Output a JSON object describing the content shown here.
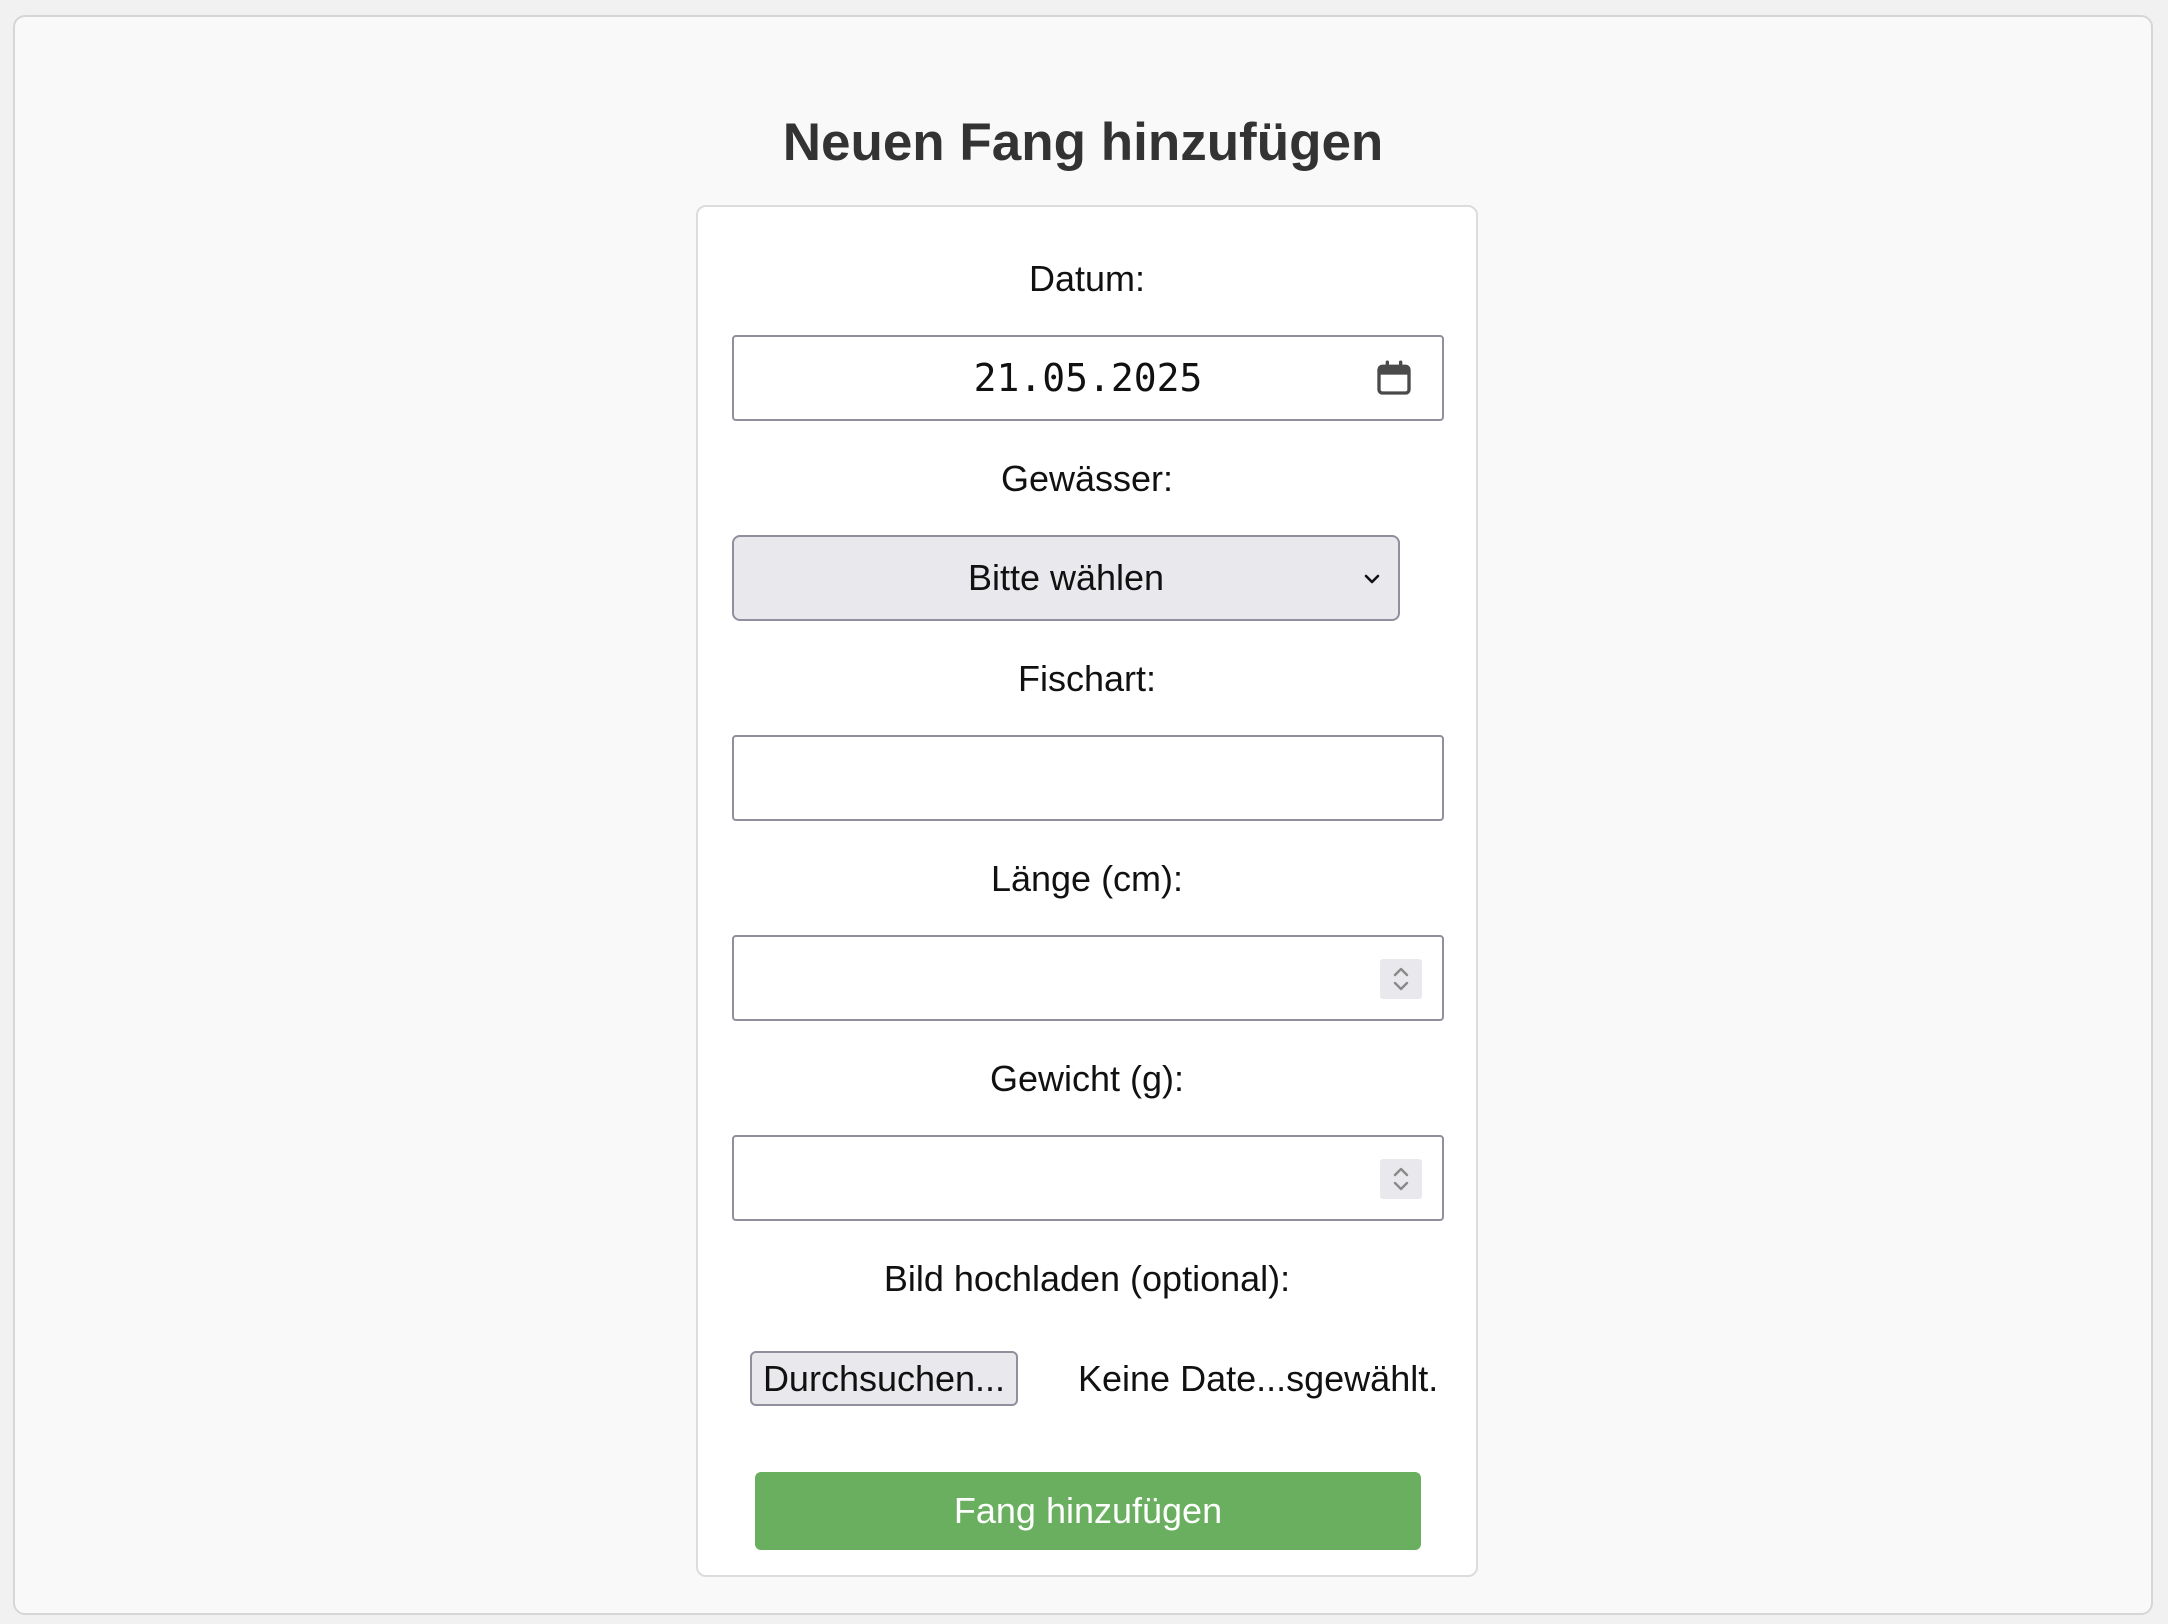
{
  "page": {
    "title": "Neuen Fang hinzufügen"
  },
  "form": {
    "date": {
      "label": "Datum:",
      "value": "21.05.2025",
      "icon": "calendar-icon"
    },
    "water": {
      "label": "Gewässer:",
      "selected": "Bitte wählen",
      "icon": "chevron-down-icon"
    },
    "species": {
      "label": "Fischart:",
      "value": ""
    },
    "length": {
      "label": "Länge (cm):",
      "value": "",
      "icon": "spinner-icon"
    },
    "weight": {
      "label": "Gewicht (g):",
      "value": "",
      "icon": "spinner-icon"
    },
    "image": {
      "label": "Bild hochladen (optional):",
      "browse_label": "Durchsuchen...",
      "status": "Keine Date...sgewählt."
    },
    "submit_label": "Fang hinzufügen"
  },
  "colors": {
    "submit_bg": "#6aaf5f",
    "title_text": "#333333",
    "select_bg": "#e9e9ed"
  }
}
